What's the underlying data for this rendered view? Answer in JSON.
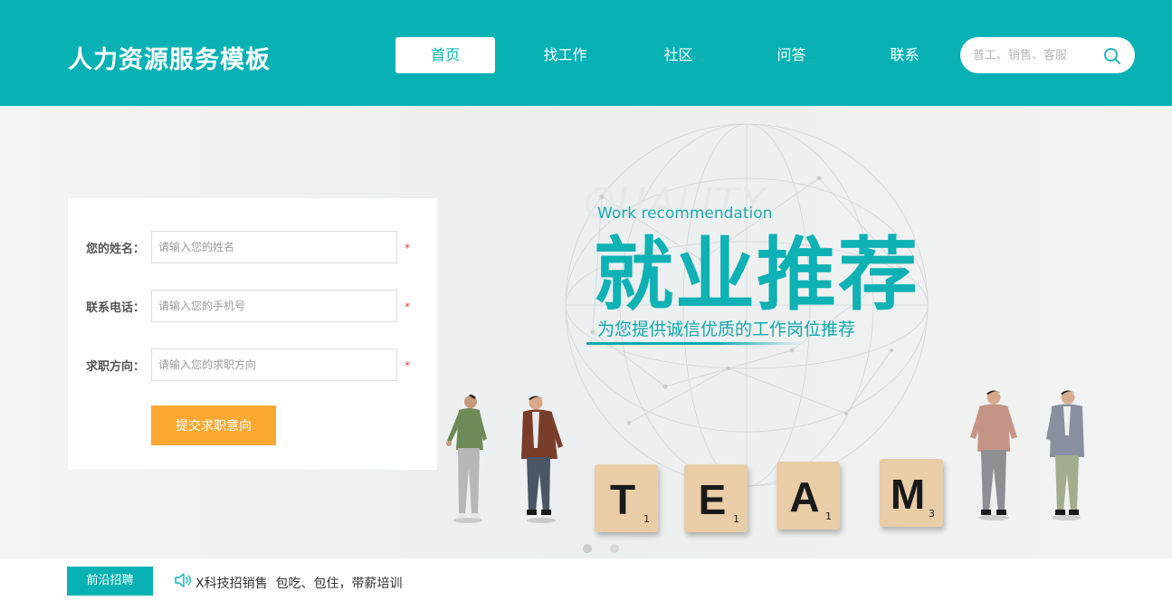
{
  "header": {
    "logo": "人力资源服务模板",
    "nav": [
      {
        "label": "首页",
        "active": true
      },
      {
        "label": "找工作",
        "active": false
      },
      {
        "label": "社区",
        "active": false
      },
      {
        "label": "问答",
        "active": false
      },
      {
        "label": "联系",
        "active": false
      }
    ],
    "search": {
      "placeholder": "普工、销售、客服",
      "icon": "search-icon"
    }
  },
  "banner": {
    "watermark": "QUALITY",
    "subtitle_en": "Work recommendation",
    "title": "就业推荐",
    "subtitle_cn": "为您提供诚信优质的工作岗位推荐",
    "tiles": [
      {
        "letter": "T",
        "num": "1"
      },
      {
        "letter": "E",
        "num": "1"
      },
      {
        "letter": "A",
        "num": "1"
      },
      {
        "letter": "M",
        "num": "3"
      }
    ],
    "slides": 2
  },
  "form": {
    "fields": [
      {
        "label": "您的姓名：",
        "placeholder": "请输入您的姓名",
        "required": "*"
      },
      {
        "label": "联系电话：",
        "placeholder": "请输入您的手机号",
        "required": "*"
      },
      {
        "label": "求职方向：",
        "placeholder": "请输入您的求职方向",
        "required": "*"
      }
    ],
    "submit_label": "提交求职意向"
  },
  "ticker": {
    "tag": "前沿招聘",
    "icon": "speaker-icon",
    "text": "X科技招销售  包吃、包住，带薪培训"
  },
  "colors": {
    "brand": "#07b1b4",
    "accent": "#faa832",
    "required": "#e83b3b"
  }
}
